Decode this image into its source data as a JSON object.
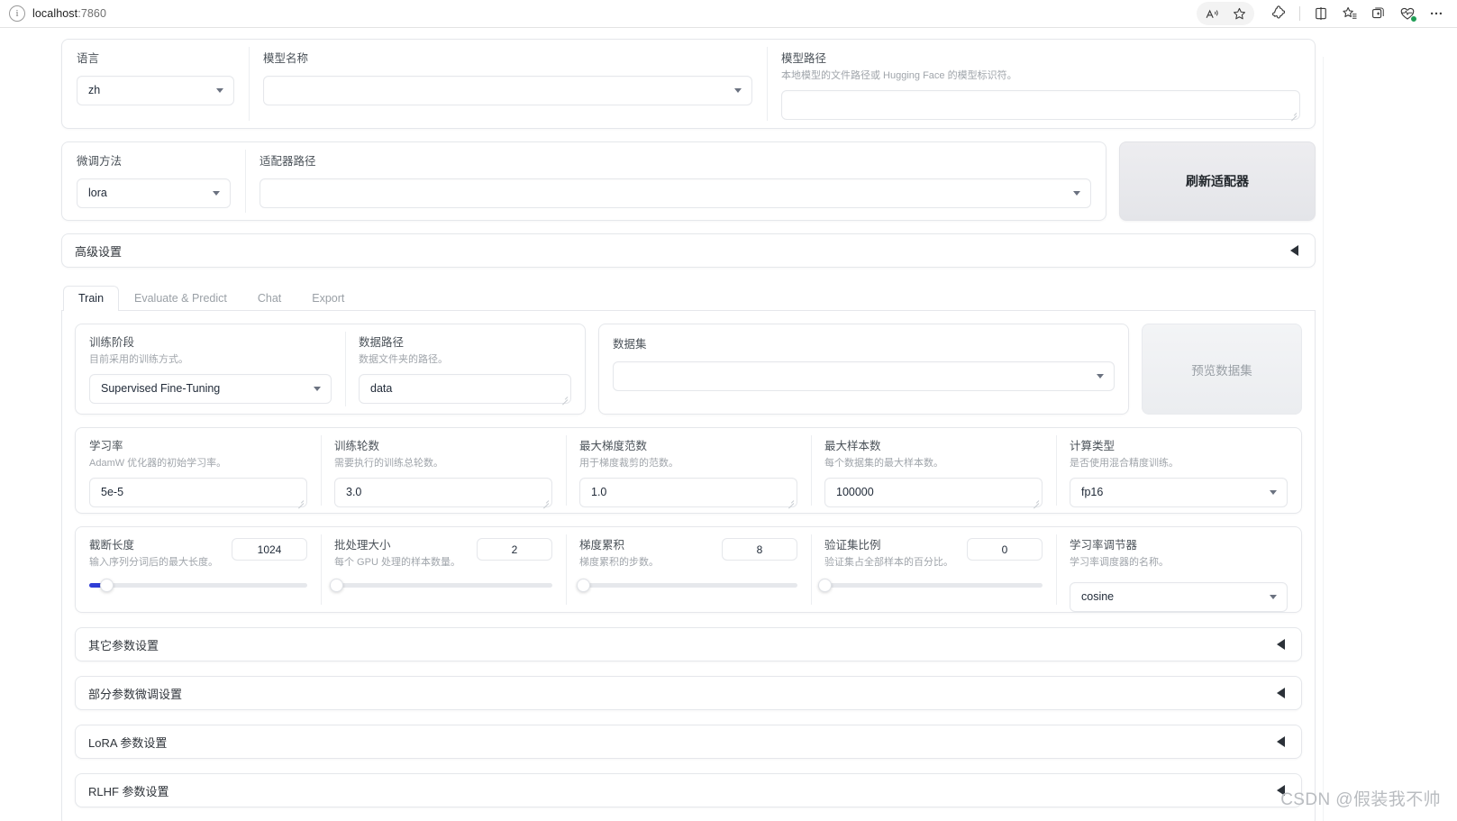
{
  "browser": {
    "url_host": "localhost",
    "url_port": ":7860",
    "site_icon": "info-icon",
    "icons": [
      {
        "name": "read-aloud-icon",
        "glyph": "A"
      },
      {
        "name": "favorite-star-icon",
        "glyph": "☆"
      },
      {
        "name": "extensions-puzzle-icon",
        "glyph": "✦"
      },
      {
        "name": "split-screen-icon",
        "glyph": "▯"
      },
      {
        "name": "add-favorites-icon",
        "glyph": "☆"
      },
      {
        "name": "collections-icon",
        "glyph": "⊕"
      },
      {
        "name": "browser-essentials-icon",
        "glyph": "♥"
      },
      {
        "name": "settings-and-more-icon",
        "glyph": "…"
      }
    ]
  },
  "top": {
    "language": {
      "label": "语言",
      "value": "zh"
    },
    "model_name": {
      "label": "模型名称",
      "value": ""
    },
    "model_path": {
      "label": "模型路径",
      "hint": "本地模型的文件路径或 Hugging Face 的模型标识符。",
      "value": ""
    },
    "finetune_method": {
      "label": "微调方法",
      "value": "lora"
    },
    "adapter_path": {
      "label": "适配器路径",
      "value": ""
    },
    "refresh_adapter_button": "刷新适配器",
    "advanced_settings": "高级设置"
  },
  "tabs": [
    {
      "label": "Train",
      "active": true
    },
    {
      "label": "Evaluate & Predict",
      "active": false
    },
    {
      "label": "Chat",
      "active": false
    },
    {
      "label": "Export",
      "active": false
    }
  ],
  "train": {
    "stage": {
      "label": "训练阶段",
      "hint": "目前采用的训练方式。",
      "value": "Supervised Fine-Tuning"
    },
    "data_dir": {
      "label": "数据路径",
      "hint": "数据文件夹的路径。",
      "value": "data"
    },
    "dataset": {
      "label": "数据集",
      "value": ""
    },
    "preview_dataset_button": "预览数据集",
    "learning_rate": {
      "label": "学习率",
      "hint": "AdamW 优化器的初始学习率。",
      "value": "5e-5"
    },
    "epochs": {
      "label": "训练轮数",
      "hint": "需要执行的训练总轮数。",
      "value": "3.0"
    },
    "max_grad_norm": {
      "label": "最大梯度范数",
      "hint": "用于梯度裁剪的范数。",
      "value": "1.0"
    },
    "max_samples": {
      "label": "最大样本数",
      "hint": "每个数据集的最大样本数。",
      "value": "100000"
    },
    "compute_type": {
      "label": "计算类型",
      "hint": "是否使用混合精度训练。",
      "value": "fp16"
    },
    "cutoff_len": {
      "label": "截断长度",
      "hint": "输入序列分词后的最大长度。",
      "value": "1024",
      "percent": 8
    },
    "batch_size": {
      "label": "批处理大小",
      "hint": "每个 GPU 处理的样本数量。",
      "value": "2",
      "percent": 2
    },
    "grad_accum": {
      "label": "梯度累积",
      "hint": "梯度累积的步数。",
      "value": "8",
      "percent": 3
    },
    "val_size": {
      "label": "验证集比例",
      "hint": "验证集占全部样本的百分比。",
      "value": "0",
      "percent": 0
    },
    "lr_scheduler": {
      "label": "学习率调节器",
      "hint": "学习率调度器的名称。",
      "value": "cosine"
    },
    "accordions": [
      "其它参数设置",
      "部分参数微调设置",
      "LoRA 参数设置",
      "RLHF 参数设置"
    ]
  },
  "watermark": "CSDN @假装我不帅"
}
